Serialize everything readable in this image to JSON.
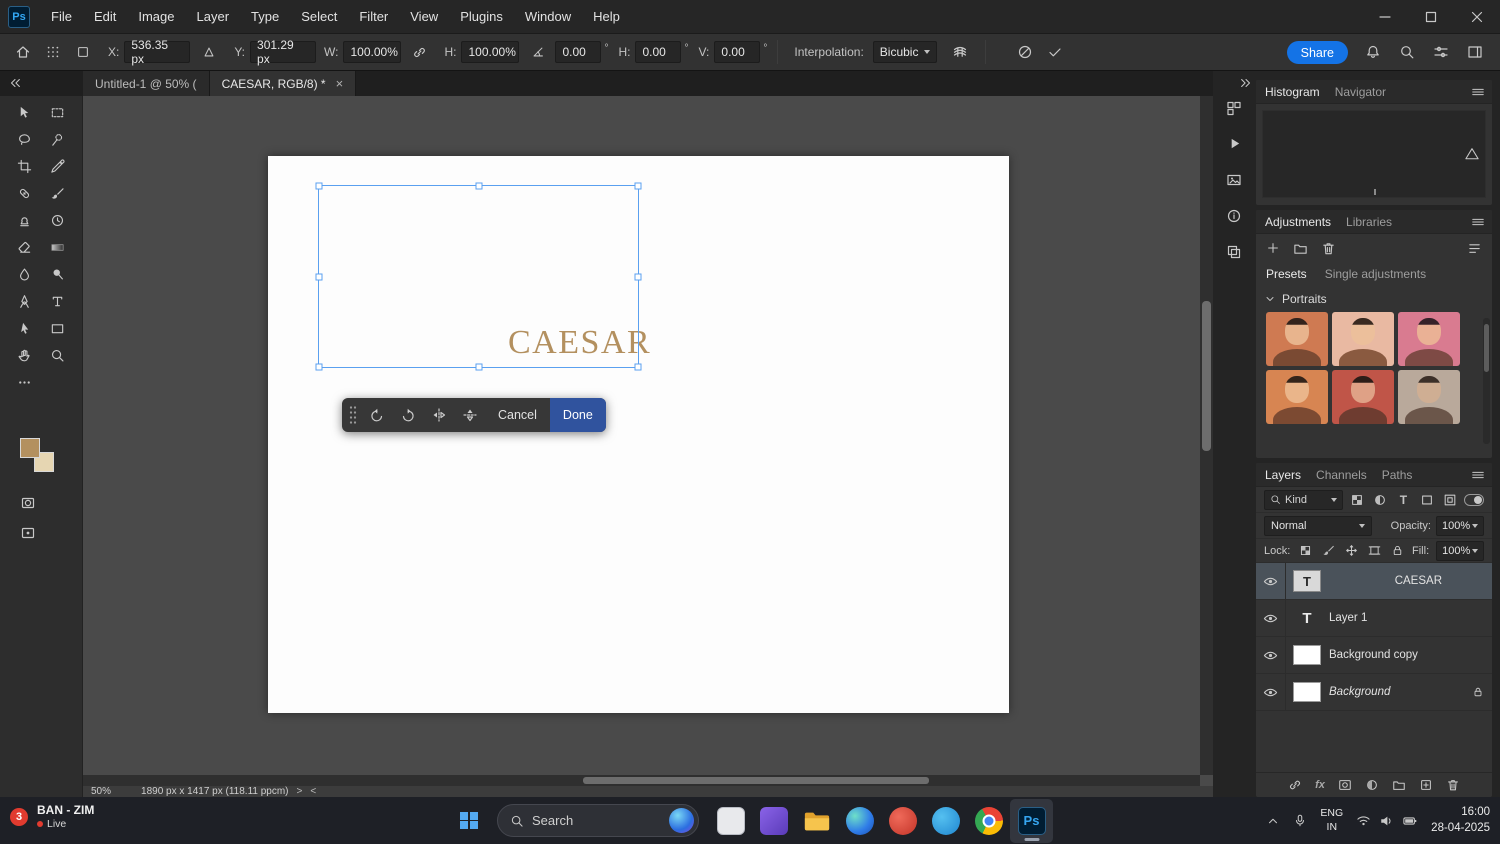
{
  "menubar": {
    "logo": "Ps",
    "items": [
      "File",
      "Edit",
      "Image",
      "Layer",
      "Type",
      "Select",
      "Filter",
      "View",
      "Plugins",
      "Window",
      "Help"
    ]
  },
  "options": {
    "x_label": "X:",
    "x_value": "536.35 px",
    "y_label": "Y:",
    "y_value": "301.29 px",
    "w_label": "W:",
    "w_value": "100.00%",
    "h_label": "H:",
    "h_value": "100.00%",
    "angle_value": "0.00",
    "skew_h_label": "H:",
    "skew_h_value": "0.00",
    "skew_v_label": "V:",
    "skew_v_value": "0.00",
    "degree": "°",
    "interpolation_label": "Interpolation:",
    "interpolation_value": "Bicubic",
    "share_label": "Share"
  },
  "tabs": {
    "tab1": "Untitled-1 @ 50% (",
    "tab2": "CAESAR, RGB/8) *",
    "close_glyph": "×"
  },
  "tools": {
    "items": [
      "move",
      "rectangular-marquee",
      "lasso",
      "quick-selection",
      "crop",
      "eyedropper",
      "spot-healing-brush",
      "brush",
      "clone-stamp",
      "history-brush",
      "eraser",
      "gradient",
      "blur",
      "dodge",
      "pen",
      "horizontal-type",
      "path-selection",
      "rectangle",
      "hand",
      "zoom",
      "edit-toolbar"
    ]
  },
  "canvas": {
    "text": "CAESAR",
    "text_color": "#b3905f"
  },
  "context_bar": {
    "cancel_label": "Cancel",
    "done_label": "Done"
  },
  "status": {
    "zoom": "50%",
    "doc_info": "1890 px x 1417 px (118.11 ppcm)",
    "chevron_right": ">",
    "chevron_left": "<"
  },
  "panels": {
    "histogram": {
      "tabs": [
        "Histogram",
        "Navigator"
      ]
    },
    "adjustments": {
      "tabs": [
        "Adjustments",
        "Libraries"
      ],
      "subtabs": [
        "Presets",
        "Single adjustments"
      ],
      "group_label": "Portraits"
    },
    "layers": {
      "tabs": [
        "Layers",
        "Channels",
        "Paths"
      ],
      "filter_label": "Kind",
      "blend_mode": "Normal",
      "opacity_label": "Opacity:",
      "opacity_value": "100%",
      "lock_label": "Lock:",
      "fill_label": "Fill:",
      "fill_value": "100%",
      "type_glyph": "T",
      "fx_glyph": "fx",
      "items": [
        {
          "name": "CAESAR"
        },
        {
          "name": "Layer 1"
        },
        {
          "name": "Background copy"
        },
        {
          "name": "Background"
        }
      ]
    }
  },
  "taskbar": {
    "widget_badge": "3",
    "widget_title": "BAN - ZIM",
    "widget_live": "Live",
    "search_label": "Search",
    "ps_glyph": "Ps",
    "lang_top": "ENG",
    "lang_bottom": "IN",
    "time": "16:00",
    "date": "28-04-2025"
  },
  "colors": {
    "accent_blue": "#1473e6",
    "done_button": "#30539e",
    "selection_outline": "#5aa0f0",
    "canvas_text": "#b3905f",
    "foreground_swatch": "#b3905f",
    "background_swatch": "#e6d6b2",
    "taskbar_badge_red": "#e13b2f"
  }
}
